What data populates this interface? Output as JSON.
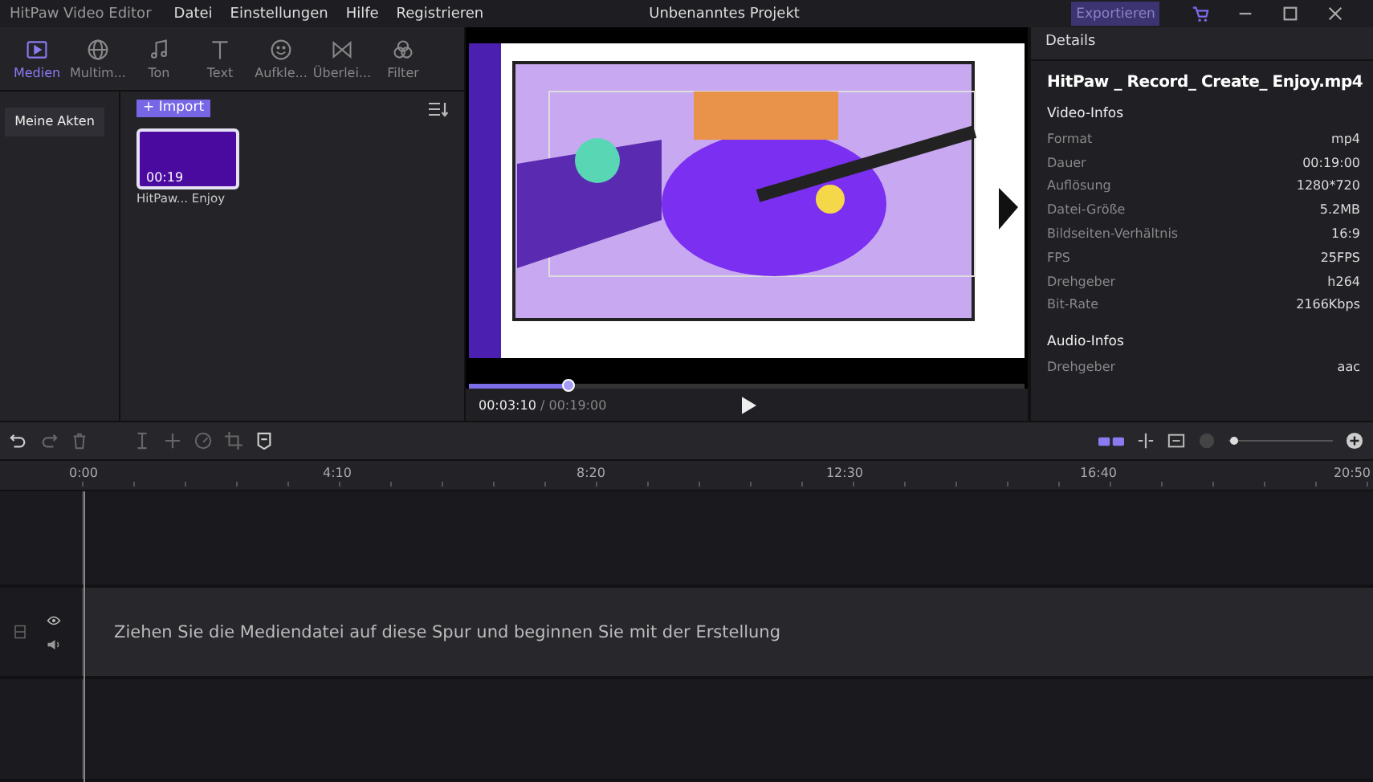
{
  "window": {
    "app_name": "HitPaw Video Editor",
    "menu": [
      "Datei",
      "Einstellungen",
      "Hilfe",
      "Registrieren"
    ],
    "title": "Unbenanntes Projekt",
    "export_button": "Exportieren"
  },
  "tabs": [
    {
      "label": "Medien",
      "kind": "media",
      "selected": true
    },
    {
      "label": "Multim...",
      "kind": "globe",
      "selected": false
    },
    {
      "label": "Ton",
      "kind": "music",
      "selected": false
    },
    {
      "label": "Text",
      "kind": "text",
      "selected": false
    },
    {
      "label": "Aufkle...",
      "kind": "smile",
      "selected": false
    },
    {
      "label": "Überlei...",
      "kind": "transition",
      "selected": false
    },
    {
      "label": "Filter",
      "kind": "filter",
      "selected": false
    }
  ],
  "sidebar": {
    "items": [
      {
        "label": "Meine Akten",
        "selected": true
      }
    ]
  },
  "media": {
    "import_button": "+ Import",
    "clips": [
      {
        "duration": "00:19",
        "name": "HitPaw... Enjoy",
        "selected": true
      }
    ]
  },
  "player": {
    "level": 0.18,
    "current_time": "00:03:10",
    "total_time": "/ 00:19:00"
  },
  "details": {
    "header": "Details",
    "file_name": "HitPaw _ Record_ Create_ Enjoy.mp4",
    "sections": [
      {
        "title": "Video-Infos",
        "rows": [
          {
            "label": "Format",
            "value": "mp4"
          },
          {
            "label": "Dauer",
            "value": "00:19:00"
          },
          {
            "label": "Auflösung",
            "value": "1280*720"
          },
          {
            "label": "Datei-Größe",
            "value": "5.2MB"
          },
          {
            "label": "Bildseiten-Verhältnis",
            "value": "16:9"
          },
          {
            "label": "FPS",
            "value": "25FPS"
          },
          {
            "label": "Drehgeber",
            "value": "h264"
          },
          {
            "label": "Bit-Rate",
            "value": "2166Kbps"
          }
        ]
      },
      {
        "title": "Audio-Infos",
        "rows": [
          {
            "label": "Drehgeber",
            "value": "aac"
          }
        ]
      }
    ]
  },
  "timeline": {
    "zoom_slider": {
      "level": 0.05
    },
    "ruler": [
      "0:00",
      "4:10",
      "8:20",
      "12:30",
      "16:40",
      "20:50"
    ],
    "drop_hint": "Ziehen Sie die Mediendatei auf diese Spur und beginnen Sie mit der Erstellung"
  }
}
